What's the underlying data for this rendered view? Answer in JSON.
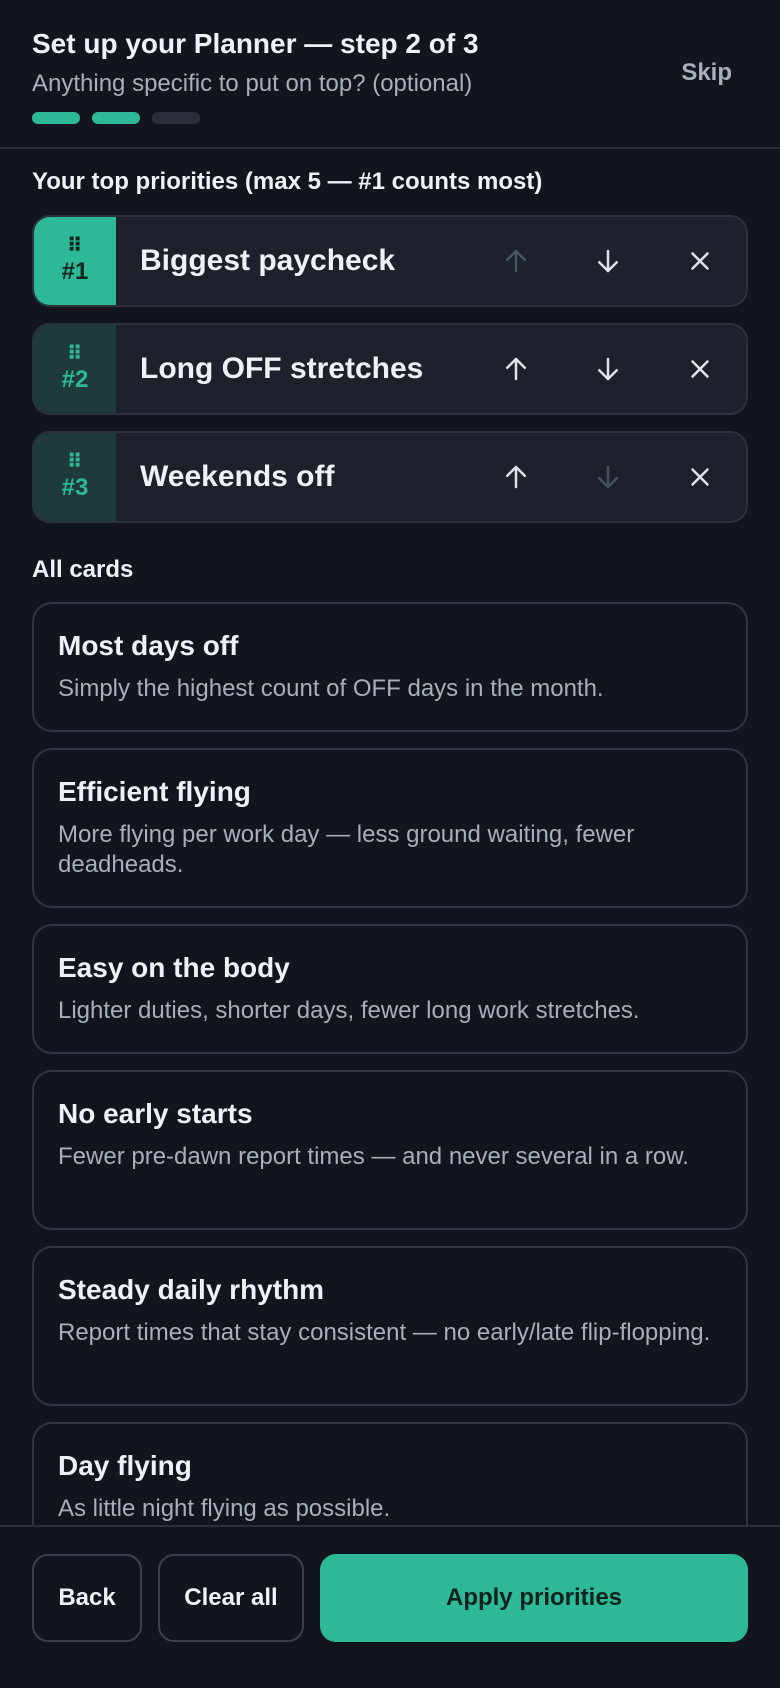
{
  "header": {
    "title": "Set up your Planner — step 2 of 3",
    "subtitle": "Anything specific to put on top? (optional)",
    "skip_label": "Skip",
    "progress_steps": [
      true,
      true,
      false
    ]
  },
  "priorities_section": {
    "label": "Your top priorities (max 5 — #1 counts most)",
    "items": [
      {
        "rank": "#1",
        "label": "Biggest paycheck",
        "up_enabled": false,
        "down_enabled": true
      },
      {
        "rank": "#2",
        "label": "Long OFF stretches",
        "up_enabled": true,
        "down_enabled": true
      },
      {
        "rank": "#3",
        "label": "Weekends off",
        "up_enabled": true,
        "down_enabled": false
      }
    ]
  },
  "cards_section": {
    "label": "All cards",
    "cards": [
      {
        "title": "Most days off",
        "desc": "Simply the highest count of OFF days in the month."
      },
      {
        "title": "Efficient flying",
        "desc": "More flying per work day — less ground waiting, fewer deadheads."
      },
      {
        "title": "Easy on the body",
        "desc": "Lighter duties, shorter days, fewer long work stretches."
      },
      {
        "title": "No early starts",
        "desc": "Fewer pre-dawn report times — and never several in a row."
      },
      {
        "title": "Steady daily rhythm",
        "desc": "Report times that stay consistent — no early/late flip-flopping."
      },
      {
        "title": "Day flying",
        "desc": "As little night flying as possible."
      }
    ]
  },
  "footer": {
    "back_label": "Back",
    "clear_label": "Clear all",
    "apply_label": "Apply priorities"
  },
  "colors": {
    "accent": "#2db898",
    "background": "#12151d",
    "surface": "#1c212b"
  }
}
